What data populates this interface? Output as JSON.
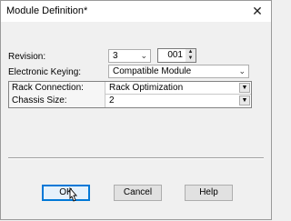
{
  "window": {
    "title": "Module Definition*",
    "close_glyph": "✕"
  },
  "form": {
    "revision": {
      "label": "Revision:",
      "major_value": "3",
      "minor_value": "001"
    },
    "keying": {
      "label": "Electronic Keying:",
      "value": "Compatible Module"
    }
  },
  "grid": {
    "rows": [
      {
        "name": "Rack Connection:",
        "value": "Rack Optimization"
      },
      {
        "name": "Chassis Size:",
        "value": "2"
      }
    ]
  },
  "buttons": {
    "ok": "OK",
    "cancel": "Cancel",
    "help": "Help"
  },
  "icons": {
    "chevron": "chevron-down-icon",
    "spin_up": "spin-up-icon",
    "spin_down": "spin-down-icon",
    "close": "close-icon",
    "cursor": "mouse-cursor-icon"
  },
  "colors": {
    "default_button_border": "#0078d7",
    "window_bg": "#f0f0f0"
  }
}
